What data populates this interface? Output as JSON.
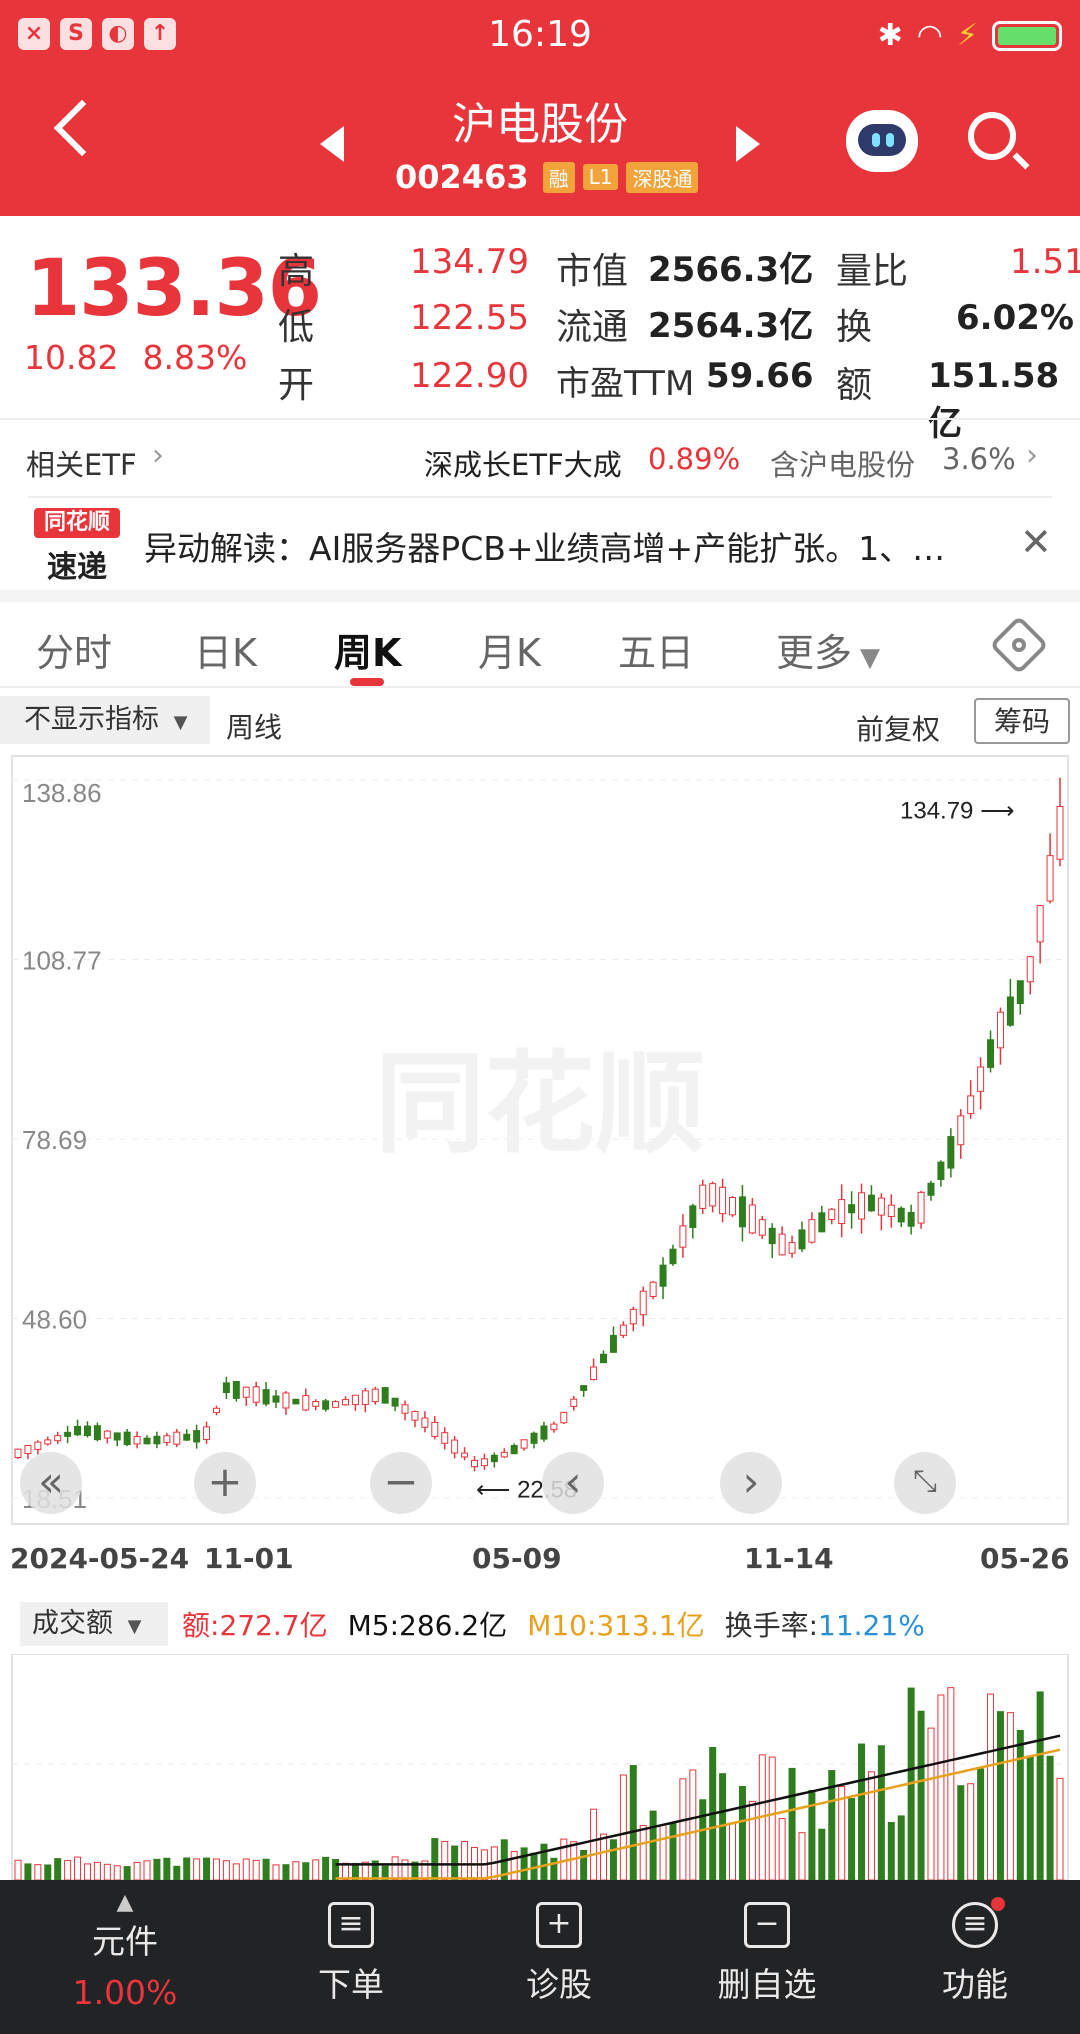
{
  "status": {
    "time": "16:19",
    "left_icons": [
      "close-app-icon",
      "sim-card-icon",
      "browser-icon",
      "upload-icon"
    ],
    "right_icons": [
      "bluetooth-icon",
      "wifi-icon",
      "charging-icon",
      "battery-icon"
    ]
  },
  "header": {
    "stock_name": "沪电股份",
    "stock_code": "002463",
    "tags": [
      "融",
      "L1",
      "深股通"
    ]
  },
  "quote": {
    "price": "133.36",
    "change": "10.82",
    "change_pct": "8.83%",
    "high_label": "高",
    "high": "134.79",
    "low_label": "低",
    "low": "122.55",
    "open_label": "开",
    "open": "122.90",
    "mcap_label": "市值",
    "mcap": "2566.3亿",
    "float_label": "流通",
    "float": "2564.3亿",
    "pe_label": "市盈TTM",
    "pe": "59.66",
    "vr_label": "量比",
    "vr": "1.51",
    "turnover_label": "换",
    "turnover": "6.02%",
    "amount_label": "额",
    "amount": "151.58亿"
  },
  "etf": {
    "label": "相关ETF",
    "name": "深成长ETF大成",
    "change": "0.89%",
    "holding_text": "含沪电股份",
    "holding_pct": "3.6%"
  },
  "news": {
    "logo_top": "同花顺",
    "logo_bottom": "速递",
    "text": "异动解读：AI服务器PCB+业绩高增+产能扩张。1、…"
  },
  "tabs": [
    "分时",
    "日K",
    "周K",
    "月K",
    "五日",
    "更多"
  ],
  "active_tab": "周K",
  "chart_toolbar": {
    "indicator": "不显示指标",
    "period": "周线",
    "adjust": "前复权",
    "chips": "筹码"
  },
  "chart_data": {
    "type": "candlestick",
    "y_ticks": [
      "138.86",
      "108.77",
      "78.69",
      "48.60",
      "18.51"
    ],
    "ylim": [
      18.51,
      138.86
    ],
    "x_ticks": [
      "2024-05-24",
      "11-01",
      "05-09",
      "11-14",
      "05-26"
    ],
    "max_label": "134.79",
    "min_label": "22.58",
    "watermark": "同花顺"
  },
  "volume": {
    "selector": "成交额",
    "amount_label": "额:",
    "amount": "272.7亿",
    "m5_label": "M5:",
    "m5": "286.2亿",
    "m10_label": "M10:",
    "m10": "313.1亿",
    "turnover_label": "换手率:",
    "turnover": "11.21%",
    "colors": {
      "amount": "#e8343b",
      "m5": "#111111",
      "m10": "#e8a11c",
      "turnover": "#2a8fd8"
    }
  },
  "bottom_bar": {
    "items": [
      {
        "label": "元件",
        "sub": "1.00%"
      },
      {
        "label": "下单"
      },
      {
        "label": "诊股"
      },
      {
        "label": "删自选"
      },
      {
        "label": "功能"
      }
    ]
  },
  "colors": {
    "accent": "#e8343b",
    "up": "#e8343b",
    "down": "#2f7d1e"
  }
}
